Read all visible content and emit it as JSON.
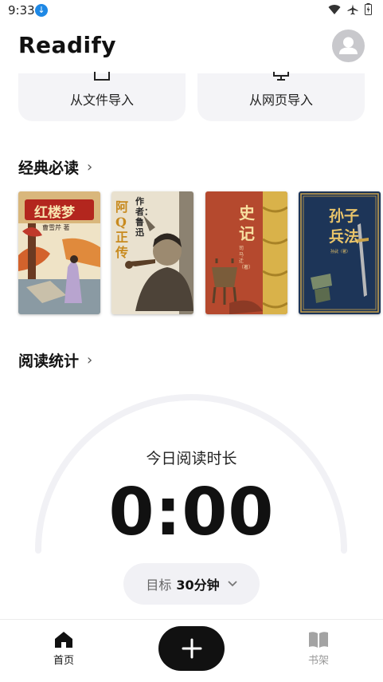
{
  "status_bar": {
    "time": "9:33"
  },
  "header": {
    "app_title": "Readify"
  },
  "import": {
    "file_label": "从文件导入",
    "web_label": "从网页导入"
  },
  "classics": {
    "title": "经典必读",
    "books": [
      {
        "title": "红楼梦",
        "author": "曹雪芹 著"
      },
      {
        "title": "阿Q正传",
        "author": "作者：鲁迅"
      },
      {
        "title": "史记",
        "author": "司马迁（著）"
      },
      {
        "title": "孙子兵法",
        "author": "孙武（著）"
      }
    ]
  },
  "stats": {
    "title": "阅读统计",
    "today_label": "今日阅读时长",
    "today_time": "0:00",
    "goal_label": "目标",
    "goal_value": "30分钟"
  },
  "nav": {
    "home_label": "首页",
    "shelf_label": "书架"
  },
  "colors": {
    "accent": "#111111",
    "card_bg": "#f4f4f7",
    "download_badge": "#1e88e5"
  }
}
